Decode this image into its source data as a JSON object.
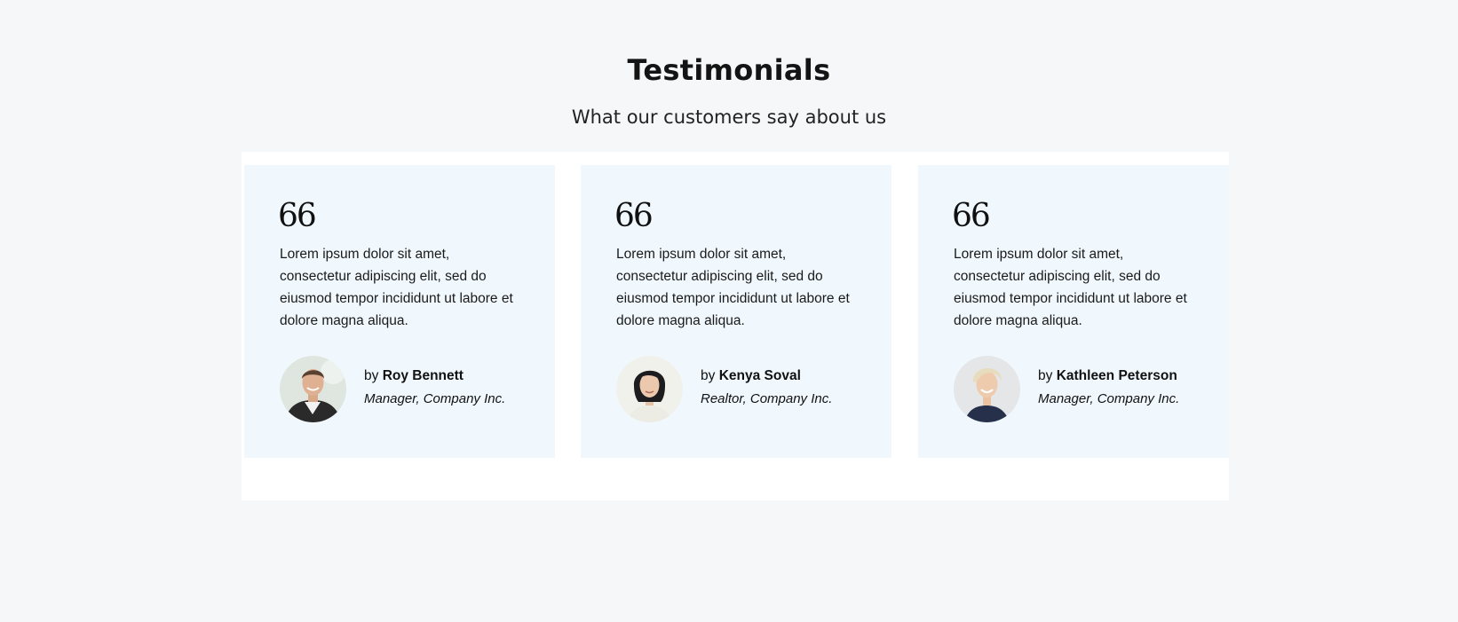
{
  "header": {
    "title": "Testimonials",
    "subtitle": "What our customers say about us"
  },
  "colors": {
    "page_background": "#f6f7f9",
    "panel_background": "#ffffff",
    "card_background": "#f0f8fe"
  },
  "testimonials": [
    {
      "quote_icon": "66",
      "icon": "quote-icon",
      "text": "Lorem ipsum dolor sit amet, consectetur adipiscing elit, sed do eiusmod tempor incididunt ut labore et dolore magna aliqua.",
      "by_prefix": "by",
      "name": "Roy Bennett",
      "role": "Manager, Company Inc."
    },
    {
      "quote_icon": "66",
      "icon": "quote-icon",
      "text": "Lorem ipsum dolor sit amet, consectetur adipiscing elit, sed do eiusmod tempor incididunt ut labore et dolore magna aliqua.",
      "by_prefix": "by",
      "name": "Kenya Soval",
      "role": "Realtor, Company Inc."
    },
    {
      "quote_icon": "66",
      "icon": "quote-icon",
      "text": "Lorem ipsum dolor sit amet, consectetur adipiscing elit, sed do eiusmod tempor incididunt ut labore et dolore magna aliqua.",
      "by_prefix": "by",
      "name": "Kathleen Peterson",
      "role": "Manager, Company Inc."
    }
  ]
}
